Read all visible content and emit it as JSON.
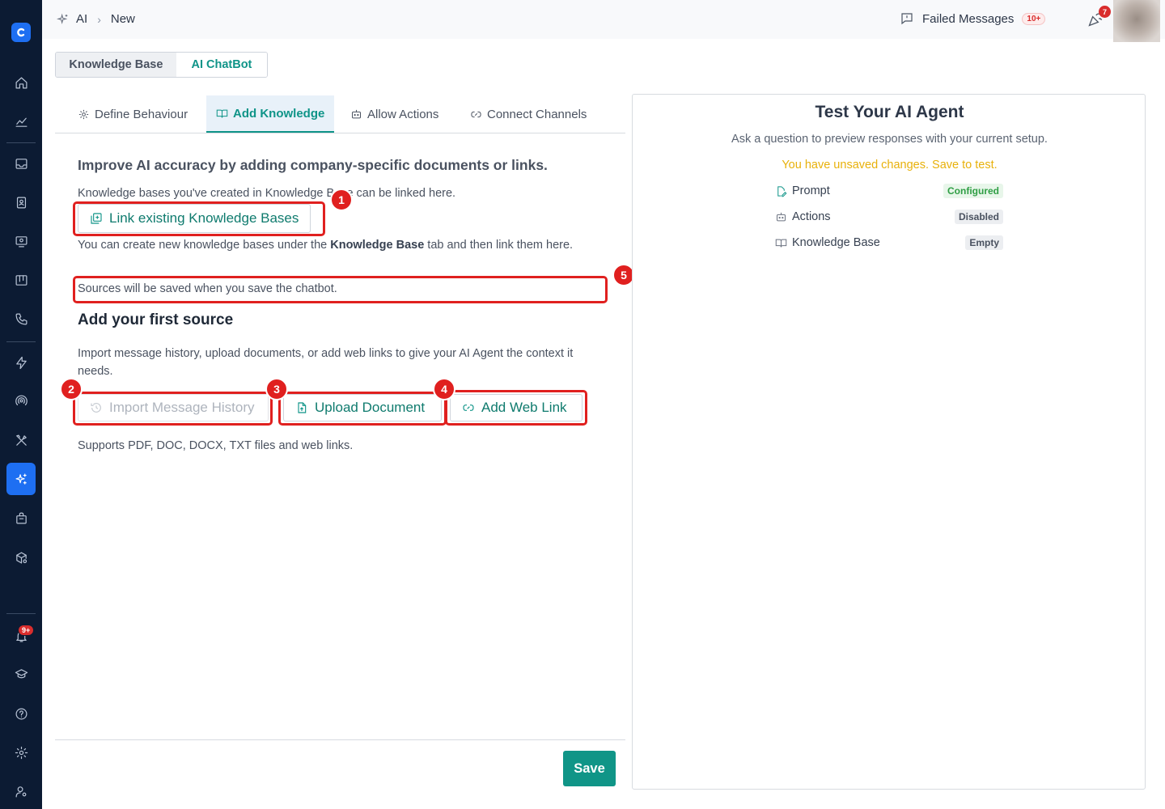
{
  "breadcrumb": {
    "section": "AI",
    "current": "New"
  },
  "header": {
    "failed_messages_label": "Failed Messages",
    "failed_messages_count": "10+",
    "notification_count": "7"
  },
  "sidebar": {
    "notification_badge": "9+",
    "items": [
      "home-icon",
      "analytics-icon",
      "inbox-icon",
      "contacts-icon",
      "monitor-icon",
      "board-icon",
      "phone-icon",
      "automation-icon",
      "broadcast-icon",
      "tools-icon",
      "ai-sparkle-icon",
      "bag-icon",
      "package-settings-icon",
      "bell-icon",
      "graduation-icon",
      "help-icon",
      "gear-icon",
      "user-settings-icon"
    ]
  },
  "top_tabs": {
    "knowledge_base": "Knowledge Base",
    "ai_chatbot": "AI ChatBot"
  },
  "sub_tabs": {
    "define_behaviour": "Define Behaviour",
    "add_knowledge": "Add Knowledge",
    "allow_actions": "Allow Actions",
    "connect_channels": "Connect Channels"
  },
  "main": {
    "intro": "Improve AI accuracy by adding company-specific documents or links.",
    "kb_note": "Knowledge bases you've created in Knowledge Base can be linked here.",
    "link_button": "Link existing Knowledge Bases",
    "create_note_before": "You can create new knowledge bases under the ",
    "create_note_bold": "Knowledge Base",
    "create_note_after": " tab and then link them here.",
    "sources_note": "Sources will be saved when you save the chatbot.",
    "first_source_heading": "Add your first source",
    "import_description": "Import message history, upload documents, or add web links to give your AI Agent the context it needs.",
    "import_button": "Import Message History",
    "upload_button": "Upload Document",
    "web_link_button": "Add Web Link",
    "supports_note": "Supports PDF, DOC, DOCX, TXT files and web links.",
    "save_button": "Save"
  },
  "annotations": [
    "1",
    "2",
    "3",
    "4",
    "5"
  ],
  "test_panel": {
    "title": "Test Your AI Agent",
    "subtitle": "Ask a question to preview responses with your current setup.",
    "warning": "You have unsaved changes. Save to test.",
    "rows": [
      {
        "label": "Prompt",
        "status": "Configured"
      },
      {
        "label": "Actions",
        "status": "Disabled"
      },
      {
        "label": "Knowledge Base",
        "status": "Empty"
      }
    ]
  },
  "colors": {
    "accent": "#0f9488",
    "sidebar_bg": "#0c1b33",
    "annotation_red": "#e0201f",
    "warning": "#e8b10b"
  }
}
